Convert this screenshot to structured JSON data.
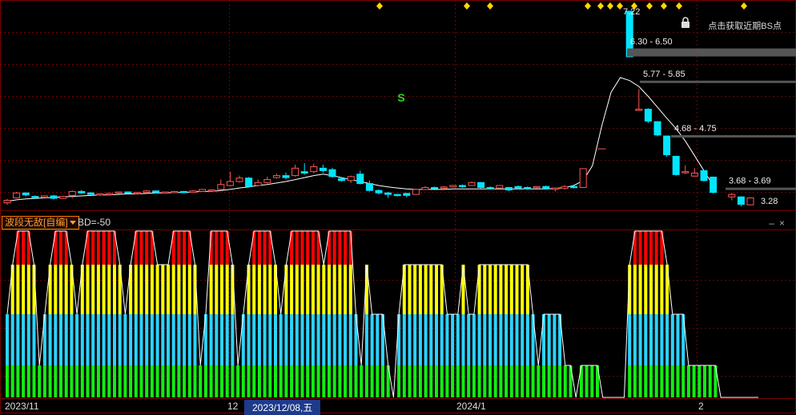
{
  "indicator": {
    "name": "波段无敌[自编]",
    "param": "BD=-50"
  },
  "header": {
    "bs_hint": "点击获取近期BS点"
  },
  "window_controls": {
    "minimize": "–",
    "close": "×"
  },
  "price_levels": [
    {
      "label": "7.22",
      "type": "high"
    },
    {
      "label": "6.30 - 6.50",
      "type": "range"
    },
    {
      "label": "5.77 - 5.85",
      "type": "range"
    },
    {
      "label": "4.68 - 4.75",
      "type": "range"
    },
    {
      "label": "3.68 - 3.69",
      "type": "range"
    },
    {
      "label": "3.28",
      "type": "low"
    }
  ],
  "signal": {
    "label": "S",
    "color": "#22dd22"
  },
  "date_axis": [
    {
      "label": "2023/11"
    },
    {
      "label": "12"
    },
    {
      "label": "2023/12/08,五",
      "active": true
    },
    {
      "label": "2024/1"
    },
    {
      "label": "2"
    }
  ],
  "colors": {
    "up": "#ff5555",
    "down": "#00e5ff",
    "ma": "#ffffff",
    "red": "#ff0000",
    "yellow": "#ffff00",
    "cyan": "#2ad4ff",
    "green": "#11ee11",
    "diamond": "#ffd700",
    "grid": "#7a0000"
  },
  "candles": [
    [
      3.35,
      3.4,
      3.31,
      3.43
    ],
    [
      3.45,
      3.55,
      3.44,
      3.57
    ],
    [
      3.55,
      3.51,
      3.48,
      3.56
    ],
    [
      3.48,
      3.46,
      3.44,
      3.5
    ],
    [
      3.46,
      3.49,
      3.45,
      3.5
    ],
    [
      3.49,
      3.44,
      3.42,
      3.51
    ],
    [
      3.44,
      3.48,
      3.43,
      3.49
    ],
    [
      3.5,
      3.58,
      3.44,
      3.6
    ],
    [
      3.58,
      3.55,
      3.53,
      3.61
    ],
    [
      3.55,
      3.52,
      3.51,
      3.57
    ],
    [
      3.52,
      3.53,
      3.49,
      3.54
    ],
    [
      3.52,
      3.54,
      3.5,
      3.55
    ],
    [
      3.55,
      3.57,
      3.53,
      3.58
    ],
    [
      3.57,
      3.55,
      3.54,
      3.58
    ],
    [
      3.55,
      3.56,
      3.53,
      3.57
    ],
    [
      3.56,
      3.59,
      3.55,
      3.61
    ],
    [
      3.59,
      3.56,
      3.55,
      3.6
    ],
    [
      3.56,
      3.57,
      3.54,
      3.58
    ],
    [
      3.57,
      3.58,
      3.55,
      3.59
    ],
    [
      3.58,
      3.56,
      3.55,
      3.59
    ],
    [
      3.56,
      3.59,
      3.55,
      3.61
    ],
    [
      3.58,
      3.62,
      3.57,
      3.63
    ],
    [
      3.6,
      3.61,
      3.58,
      3.62
    ],
    [
      3.62,
      3.72,
      3.61,
      3.82
    ],
    [
      3.7,
      3.78,
      3.68,
      3.98
    ],
    [
      3.78,
      3.85,
      3.76,
      3.9
    ],
    [
      3.85,
      3.68,
      3.66,
      3.87
    ],
    [
      3.7,
      3.76,
      3.68,
      3.82
    ],
    [
      3.76,
      3.82,
      3.74,
      3.88
    ],
    [
      3.86,
      3.9,
      3.84,
      3.94
    ],
    [
      3.9,
      3.86,
      3.82,
      3.96
    ],
    [
      3.9,
      4.05,
      3.88,
      4.12
    ],
    [
      3.98,
      3.95,
      3.92,
      4.15
    ],
    [
      3.98,
      4.08,
      3.95,
      4.14
    ],
    [
      4.05,
      4.0,
      3.96,
      4.12
    ],
    [
      4.02,
      3.88,
      3.86,
      4.06
    ],
    [
      3.84,
      3.8,
      3.78,
      3.86
    ],
    [
      3.8,
      3.88,
      3.75,
      3.9
    ],
    [
      3.93,
      3.74,
      3.72,
      4.0
    ],
    [
      3.74,
      3.6,
      3.58,
      3.8
    ],
    [
      3.6,
      3.55,
      3.52,
      3.62
    ],
    [
      3.55,
      3.52,
      3.45,
      3.57
    ],
    [
      3.52,
      3.51,
      3.48,
      3.53
    ],
    [
      3.54,
      3.5,
      3.46,
      3.55
    ],
    [
      3.52,
      3.62,
      3.51,
      3.63
    ],
    [
      3.62,
      3.66,
      3.61,
      3.69
    ],
    [
      3.66,
      3.65,
      3.63,
      3.68
    ],
    [
      3.65,
      3.67,
      3.62,
      3.69
    ],
    [
      3.67,
      3.7,
      3.66,
      3.71
    ],
    [
      3.7,
      3.68,
      3.66,
      3.72
    ],
    [
      3.7,
      3.76,
      3.69,
      3.78
    ],
    [
      3.76,
      3.66,
      3.64,
      3.77
    ],
    [
      3.66,
      3.65,
      3.62,
      3.68
    ],
    [
      3.65,
      3.7,
      3.64,
      3.71
    ],
    [
      3.66,
      3.61,
      3.59,
      3.67
    ],
    [
      3.68,
      3.65,
      3.63,
      3.7
    ],
    [
      3.66,
      3.64,
      3.62,
      3.68
    ],
    [
      3.66,
      3.68,
      3.64,
      3.69
    ],
    [
      3.68,
      3.64,
      3.62,
      3.7
    ],
    [
      3.64,
      3.65,
      3.58,
      3.66
    ],
    [
      3.64,
      3.68,
      3.62,
      3.71
    ],
    [
      3.68,
      3.66,
      3.64,
      3.72
    ],
    [
      3.66,
      4.04,
      3.65,
      4.04
    ],
    [
      null,
      null,
      null,
      null
    ],
    [
      4.44,
      null,
      null,
      4.44
    ],
    [
      null,
      null,
      null,
      null
    ],
    [
      null,
      null,
      null,
      null
    ],
    [
      7.22,
      6.3,
      6.29,
      7.22
    ],
    [
      5.22,
      5.24,
      5.23,
      5.65
    ],
    [
      5.24,
      5.0,
      4.96,
      5.26
    ],
    [
      4.99,
      4.72,
      4.69,
      5.0
    ],
    [
      4.7,
      4.32,
      4.28,
      4.71
    ],
    [
      4.29,
      3.92,
      3.9,
      4.3
    ],
    [
      3.96,
      3.98,
      3.93,
      4.11
    ],
    [
      3.89,
      3.95,
      3.88,
      4.05
    ],
    [
      4.0,
      3.8,
      3.78,
      4.01
    ],
    [
      3.87,
      3.56,
      3.54,
      3.88
    ],
    [
      null,
      null,
      null,
      null
    ],
    [
      3.47,
      3.52,
      3.4,
      3.55
    ],
    [
      3.47,
      3.32,
      3.28,
      3.48
    ],
    [
      3.31,
      3.45,
      3.3,
      3.46
    ],
    [
      null,
      null,
      null,
      null
    ],
    [
      null,
      null,
      null,
      null
    ],
    [
      null,
      null,
      null,
      null
    ]
  ],
  "ma": [
    3.38,
    3.41,
    3.43,
    3.44,
    3.45,
    3.46,
    3.47,
    3.48,
    3.49,
    3.5,
    3.51,
    3.51,
    3.52,
    3.53,
    3.53,
    3.54,
    3.55,
    3.55,
    3.56,
    3.56,
    3.57,
    3.58,
    3.58,
    3.6,
    3.62,
    3.65,
    3.67,
    3.7,
    3.72,
    3.75,
    3.78,
    3.82,
    3.86,
    3.9,
    3.93,
    3.9,
    3.86,
    3.82,
    3.78,
    3.74,
    3.7,
    3.67,
    3.65,
    3.63,
    3.62,
    3.62,
    3.62,
    3.62,
    3.63,
    3.63,
    3.63,
    3.63,
    3.63,
    3.63,
    3.63,
    3.63,
    3.63,
    3.63,
    3.63,
    3.64,
    3.66,
    3.7,
    3.8,
    4.1,
    4.9,
    5.58,
    5.88,
    5.82,
    5.7,
    5.5,
    5.28,
    5.06,
    4.85,
    4.6,
    4.3,
    4.0,
    3.7
  ],
  "levels_pos": [
    [
      7.22,
      7.22
    ],
    [
      6.5,
      6.5
    ],
    [
      5.85,
      5.85
    ],
    [
      4.75,
      4.75
    ],
    [
      3.69,
      3.69
    ],
    [
      3.28,
      3.28
    ]
  ],
  "diamonds": [
    474,
    583,
    612,
    734,
    750,
    762,
    774,
    792,
    811,
    829,
    848,
    929
  ],
  "indicator_bars": [
    2,
    3,
    4,
    4,
    4,
    3,
    1,
    2,
    3,
    4,
    4,
    4,
    3,
    2,
    3,
    4,
    4,
    4,
    4,
    4,
    4,
    3,
    2,
    3,
    4,
    4,
    4,
    4,
    3,
    3,
    3,
    4,
    4,
    4,
    4,
    3,
    1,
    2,
    4,
    4,
    4,
    4,
    3,
    1,
    2,
    3,
    4,
    4,
    4,
    4,
    3,
    2,
    3,
    4,
    4,
    4,
    4,
    4,
    4,
    3,
    4,
    4,
    4,
    4,
    4,
    2,
    1,
    3,
    2,
    2,
    2,
    1,
    0,
    2,
    3,
    3,
    3,
    3,
    3,
    3,
    3,
    3,
    2,
    2,
    2,
    3,
    2,
    2,
    3,
    3,
    3,
    3,
    3,
    3,
    3,
    3,
    3,
    3,
    2,
    1,
    2,
    2,
    2,
    2,
    1,
    1,
    0,
    1,
    1,
    1,
    1,
    0,
    0,
    0,
    0,
    0,
    3,
    4,
    4,
    4,
    4,
    4,
    4,
    3,
    2,
    2,
    2,
    1,
    1,
    1,
    1,
    1,
    1,
    0,
    0,
    0,
    0,
    0,
    0,
    0,
    0
  ]
}
